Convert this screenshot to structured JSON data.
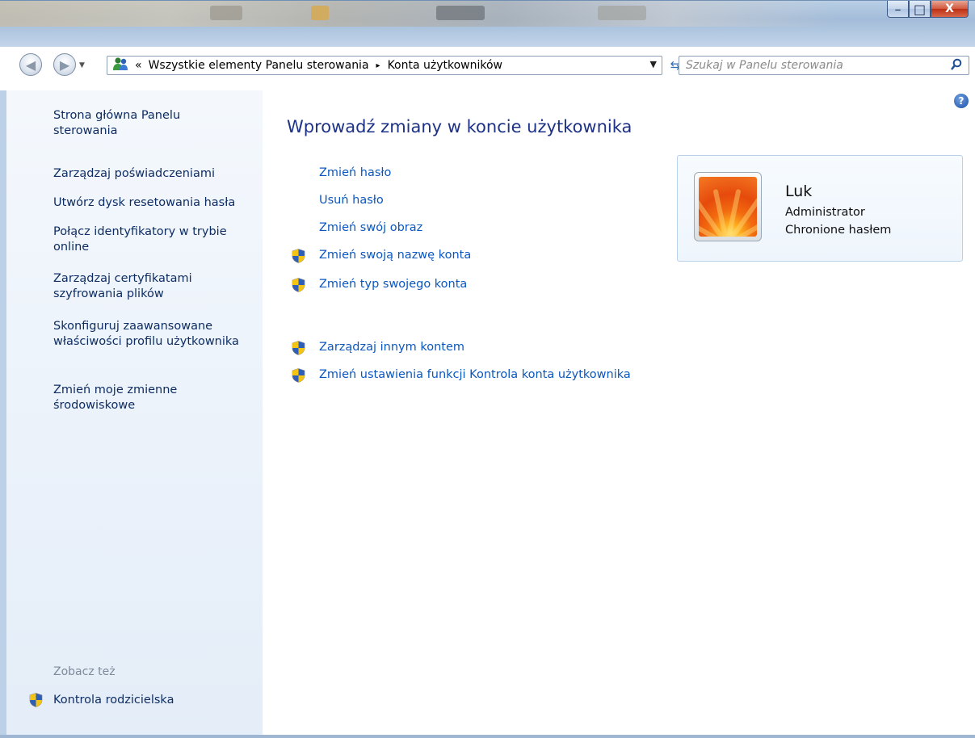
{
  "window": {
    "controls": {
      "minimize": "–",
      "maximize": "□",
      "close": "X"
    }
  },
  "navigation": {
    "back_icon": "back-arrow-icon",
    "forward_icon": "forward-arrow-icon",
    "breadcrumb_prefix": "«",
    "breadcrumb": [
      "Wszystkie elementy Panelu sterowania",
      "Konta użytkowników"
    ],
    "separator": "▸",
    "search_placeholder": "Szukaj w Panelu sterowania"
  },
  "sidebar": {
    "links": [
      "Strona główna Panelu sterowania",
      "Zarządzaj poświadczeniami",
      "Utwórz dysk resetowania hasła",
      "Połącz identyfikatory w trybie online",
      "Zarządzaj certyfikatami szyfrowania plików",
      "Skonfiguruj zaawansowane właściwości profilu użytkownika",
      "Zmień moje zmienne środowiskowe"
    ],
    "see_also_label": "Zobacz też",
    "see_also": [
      "Kontrola rodzicielska"
    ]
  },
  "main": {
    "heading": "Wprowadź zmiany w koncie użytkownika",
    "tasks": [
      "Zmień hasło",
      "Usuń hasło",
      "Zmień swój obraz",
      "Zmień swoją nazwę konta",
      "Zmień typ swojego konta"
    ],
    "other_tasks": [
      "Zarządzaj innym kontem",
      "Zmień ustawienia funkcji Kontrola konta użytkownika"
    ],
    "help": "?"
  },
  "user": {
    "name": "Luk",
    "role": "Administrator",
    "status": "Chronione hasłem"
  },
  "colors": {
    "link": "#0b57bf",
    "heading": "#1e3287",
    "sidebar_link": "#0e2d63",
    "muted": "#7c8a9b"
  }
}
